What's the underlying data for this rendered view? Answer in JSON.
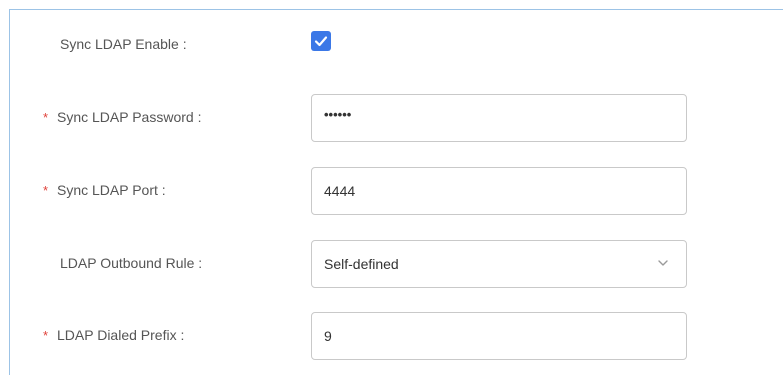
{
  "form": {
    "sync_enable": {
      "label": "Sync LDAP Enable :",
      "checked": true
    },
    "sync_password": {
      "label": "Sync LDAP Password :",
      "required_mark": "*",
      "value": "••••••"
    },
    "sync_port": {
      "label": "Sync LDAP Port :",
      "required_mark": "*",
      "value": "4444"
    },
    "outbound_rule": {
      "label": "LDAP Outbound Rule :",
      "selected": "Self-defined"
    },
    "dialed_prefix": {
      "label": "LDAP Dialed Prefix :",
      "required_mark": "*",
      "value": "9"
    }
  },
  "colors": {
    "accent": "#3b78e7",
    "required": "#e0413a",
    "border": "#c9c9c9",
    "frame": "#9cc3e6"
  },
  "icons": {
    "checkbox": "checkmark-icon",
    "select": "chevron-down-icon"
  }
}
